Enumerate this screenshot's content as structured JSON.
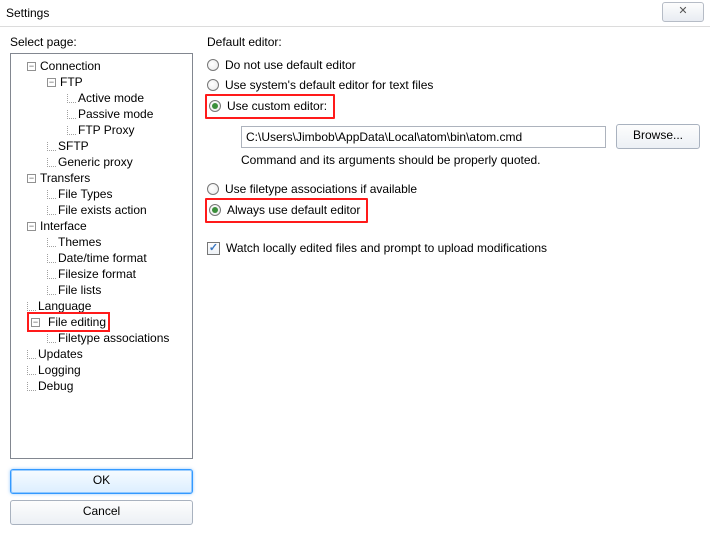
{
  "window": {
    "title": "Settings"
  },
  "select_page_label": "Select page:",
  "tree": {
    "connection": "Connection",
    "ftp": "FTP",
    "active_mode": "Active mode",
    "passive_mode": "Passive mode",
    "ftp_proxy": "FTP Proxy",
    "sftp": "SFTP",
    "generic_proxy": "Generic proxy",
    "transfers": "Transfers",
    "file_types": "File Types",
    "file_exists": "File exists action",
    "interface": "Interface",
    "themes": "Themes",
    "date_time": "Date/time format",
    "filesize": "Filesize format",
    "file_lists": "File lists",
    "language": "Language",
    "file_editing": "File editing",
    "filetype_assoc": "Filetype associations",
    "updates": "Updates",
    "logging": "Logging",
    "debug": "Debug"
  },
  "buttons": {
    "ok": "OK",
    "cancel": "Cancel",
    "browse": "Browse..."
  },
  "editor": {
    "section_label": "Default editor:",
    "opt_none": "Do not use default editor",
    "opt_system": "Use system's default editor for text files",
    "opt_custom": "Use custom editor:",
    "path": "C:\\Users\\Jimbob\\AppData\\Local\\atom\\bin\\atom.cmd",
    "quote_hint": "Command and its arguments should be properly quoted.",
    "opt_filetype": "Use filetype associations if available",
    "opt_always": "Always use default editor",
    "watch_label": "Watch locally edited files and prompt to upload modifications"
  }
}
